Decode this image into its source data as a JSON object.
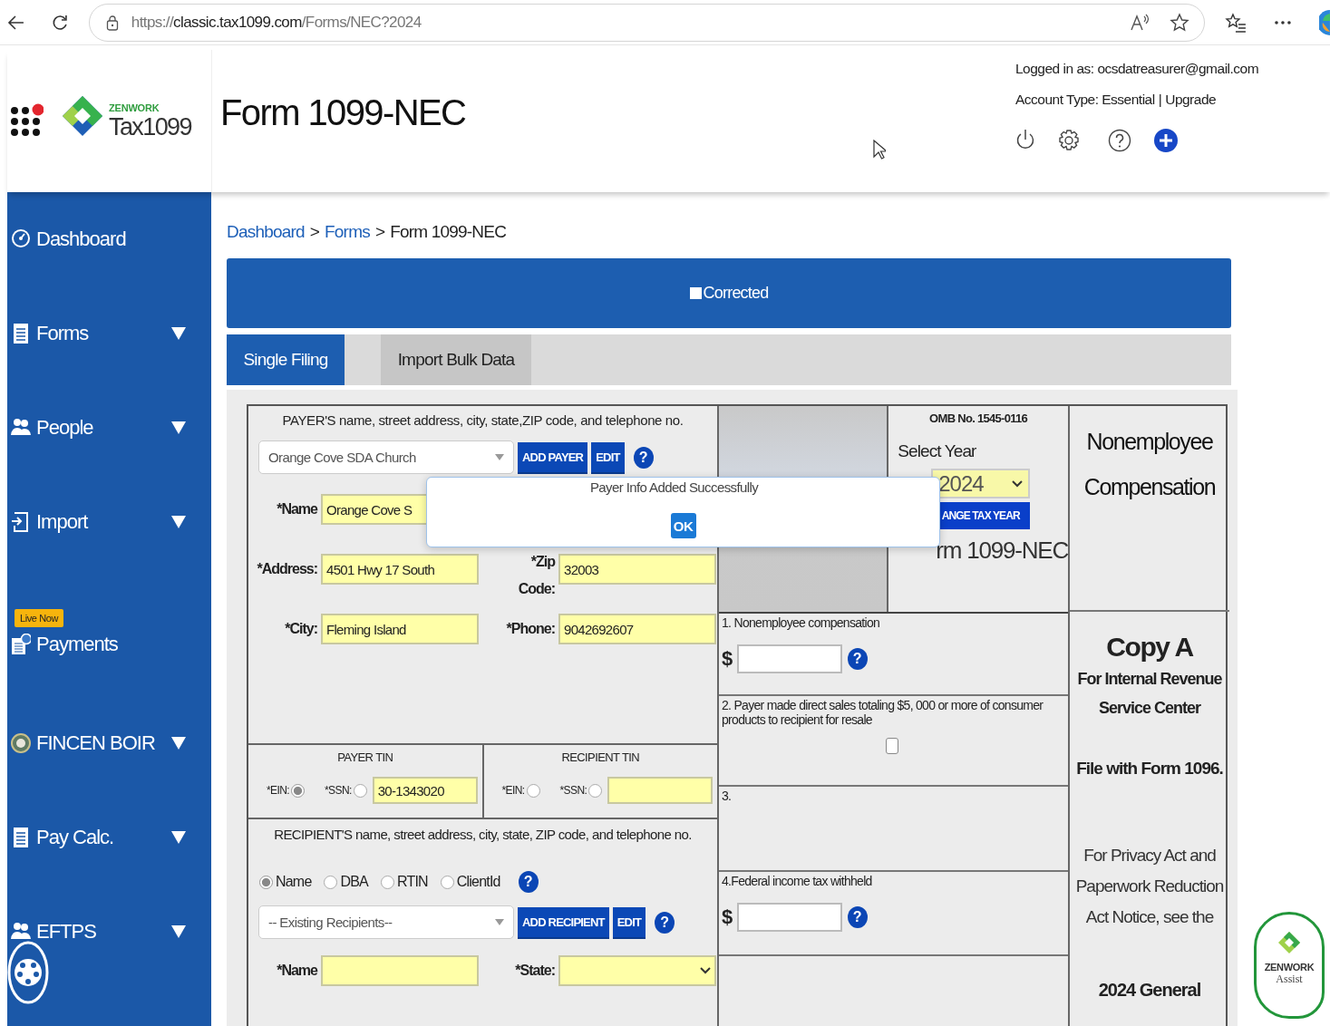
{
  "browser": {
    "scheme": "https://",
    "host": "classic.tax1099.com",
    "path": "/Forms/NEC?2024"
  },
  "header": {
    "brand_top": "ZENWORK",
    "brand": "Tax1099",
    "title": "Form 1099-NEC",
    "logged_in": "Logged in as: ocsdatreasurer@gmail.com",
    "account_type": "Account Type: Essential",
    "separator": "|",
    "upgrade": "Upgrade"
  },
  "sidebar": {
    "items": [
      {
        "kind": "gauge",
        "label": "Dashboard",
        "expandable": false
      },
      {
        "kind": "document",
        "label": "Forms",
        "expandable": true
      },
      {
        "kind": "people",
        "label": "People",
        "expandable": true
      },
      {
        "kind": "import",
        "label": "Import",
        "expandable": true
      },
      {
        "kind": "payments",
        "label": "Payments",
        "badge": "Live Now",
        "expandable": false
      },
      {
        "kind": "seal",
        "label": "FINCEN BOIR",
        "expandable": true
      },
      {
        "kind": "document",
        "label": "Pay Calc.",
        "expandable": true
      },
      {
        "kind": "people",
        "label": "EFTPS",
        "expandable": true
      }
    ]
  },
  "breadcrumb": [
    {
      "label": "Dashboard",
      "link": true
    },
    {
      "separator": ">",
      "label": "Forms",
      "link": true
    },
    {
      "separator": ">",
      "label": "Form 1099-NEC",
      "link": false
    }
  ],
  "corrected": {
    "label": "Corrected",
    "checked": false
  },
  "tabs": [
    {
      "label": "Single Filing",
      "selected": true
    },
    {
      "label": "Import Bulk Data",
      "selected": false
    }
  ],
  "payer": {
    "heading": "PAYER'S name, street address, city, state,ZIP code, and telephone no.",
    "select_value": "Orange Cove SDA Church",
    "add_button": "ADD PAYER",
    "edit_button": "EDIT",
    "help": "?",
    "fields": [
      {
        "label": "*Name",
        "value": "Orange Cove S"
      },
      {
        "label": "*Address:",
        "value": "4501 Hwy 17 South"
      },
      {
        "label": "*Zip Code:",
        "value": "32003"
      },
      {
        "label": "*City:",
        "value": "Fleming Island"
      },
      {
        "label": "*Phone:",
        "value": "9042692607"
      }
    ]
  },
  "payer_tin": {
    "heading": "PAYER TIN",
    "options": [
      {
        "label": "*EIN:",
        "selected": true
      },
      {
        "label": "*SSN:",
        "selected": false
      }
    ],
    "value": "30-1343020"
  },
  "recipient_tin": {
    "heading": "RECIPIENT TIN",
    "options": [
      {
        "label": "*EIN:",
        "selected": false
      },
      {
        "label": "*SSN:",
        "selected": false
      }
    ]
  },
  "recipient": {
    "heading": "RECIPIENT'S name, street address, city, state, ZIP code, and telephone no.",
    "search_by": [
      {
        "label": "Name",
        "selected": true
      },
      {
        "label": "DBA",
        "selected": false
      },
      {
        "label": "RTIN",
        "selected": false
      },
      {
        "label": "ClientId",
        "selected": false
      }
    ],
    "search_help": "?",
    "select_placeholder": "-- Existing Recipients--",
    "add_button": "ADD RECIPIENT",
    "edit_button": "EDIT",
    "help": "?",
    "fields": [
      {
        "kind": "text",
        "label": "*Name"
      },
      {
        "kind": "select",
        "label": "*State:"
      }
    ]
  },
  "form_info": {
    "omb": "OMB No. 1545-0116",
    "year_label": "Select Year",
    "year": "2024",
    "change_button": "ANGE TAX YEAR",
    "form_name": "rm 1099-NEC"
  },
  "boxes": [
    {
      "kind": "amount",
      "label": "1. Nonemployee compensation",
      "currency": "$",
      "help": "?"
    },
    {
      "kind": "checkbox",
      "label": "2. Payer made direct sales totaling $5, 000 or more of consumer products to recipient for resale",
      "checked": false
    },
    {
      "kind": "blank",
      "label": "3."
    },
    {
      "kind": "amount",
      "label": "4.Federal income tax withheld",
      "currency": "$",
      "help": "?"
    }
  ],
  "copy_info": {
    "title": "Nonemployee Compensation",
    "copy": "Copy A",
    "recipient_note": "For Internal Revenue Service Center",
    "file_note": "File with Form 1096.",
    "privacy_note": "For Privacy Act and Paperwork Reduction Act Notice, see the",
    "instructions": "2024 General"
  },
  "dialog": {
    "message": "Payer Info Added Successfully",
    "button": "OK"
  },
  "assist": {
    "brand": "ZENWORK",
    "label": "Assist"
  }
}
